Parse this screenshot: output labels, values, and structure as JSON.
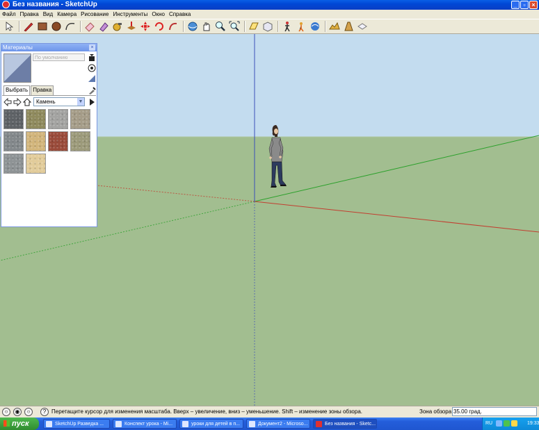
{
  "window": {
    "title": "Без названия - SketchUp",
    "controls": [
      "_",
      "▫",
      "×"
    ]
  },
  "menu": [
    "Файл",
    "Правка",
    "Вид",
    "Камера",
    "Рисование",
    "Инструменты",
    "Окно",
    "Справка"
  ],
  "toolbar": {
    "tools": [
      "select-icon",
      "pencil-icon",
      "rectangle-icon",
      "circle-icon",
      "arc-icon",
      "eraser-icon",
      "paint-bucket-icon",
      "tape-measure-icon",
      "push-pull-icon",
      "move-icon",
      "rotate-icon",
      "follow-me-icon",
      "orbit-icon",
      "pan-icon",
      "zoom-icon",
      "zoom-extents-icon",
      "section-plane-icon",
      "components-icon",
      "walk-icon",
      "position-camera-icon",
      "look-around-icon",
      "sandbox-icon",
      "styles-icon",
      "layers-icon"
    ]
  },
  "materials_panel": {
    "title": "Материалы",
    "close": "×",
    "material_name_placeholder": "По умолчанию",
    "tabs": [
      "Выбрать",
      "Правка"
    ],
    "library": "Камень",
    "library_arrow": "▼",
    "swatches": [
      {
        "color": "#5e6266"
      },
      {
        "color": "#8f8a5d"
      },
      {
        "color": "#a3a3a1"
      },
      {
        "color": "#a59c88"
      },
      {
        "color": "#83888b"
      },
      {
        "color": "#d2b57b"
      },
      {
        "color": "#9a4b3a"
      },
      {
        "color": "#9c9a7a"
      },
      {
        "color": "#8e9395"
      },
      {
        "color": "#e2cc9a"
      }
    ]
  },
  "status": {
    "hint": "Перетащите курсор для изменения масштаба.  Вверх – увеличение, вниз – уменьшение. Shift – изменение зоны обзора.",
    "fov_label": "Зона обзора",
    "fov_value": "35.00 град.",
    "help_glyph": "?"
  },
  "taskbar": {
    "start": "пуск",
    "tasks": [
      "SketchUp Разведка ...",
      "Конспект урока - Mi...",
      "уроки для детей в п...",
      "Документ2 - Microso...",
      "Без названия - Sketc..."
    ],
    "lang": "RU",
    "time": "19:33"
  },
  "colors": {
    "sky": "#c3dcef",
    "ground": "#a2be90",
    "horizon": "#aec7a2",
    "red_axis": "#c23d2f",
    "green_axis": "#2aa02a",
    "blue_axis": "#3b4fb8"
  }
}
